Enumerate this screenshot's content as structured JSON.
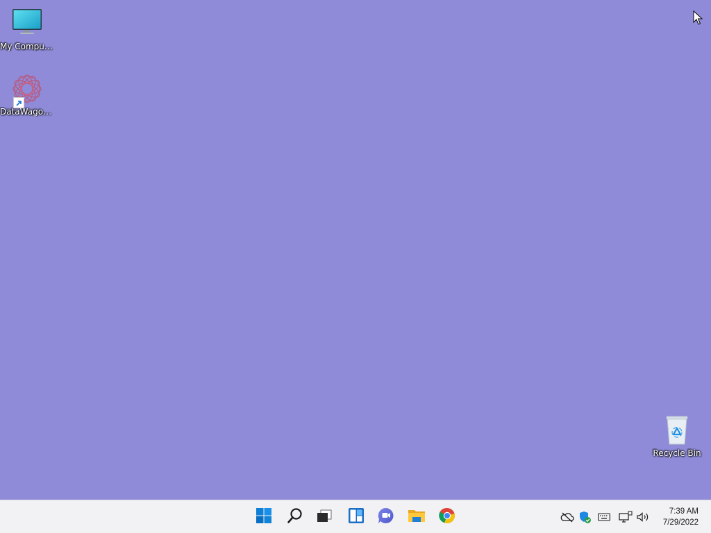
{
  "desktop": {
    "background_color": "#8f8bd8",
    "icons": [
      {
        "label": "My Computer",
        "icon": "monitor-icon"
      },
      {
        "label": "DataWagon...",
        "icon": "datawagon-shortcut-icon"
      },
      {
        "label": "Recycle Bin",
        "icon": "recycle-bin-icon"
      }
    ]
  },
  "taskbar": {
    "background_color": "#f2f2f4",
    "pinned": [
      {
        "name": "Start",
        "icon": "windows-start-icon"
      },
      {
        "name": "Search",
        "icon": "search-icon"
      },
      {
        "name": "Task View",
        "icon": "task-view-icon"
      },
      {
        "name": "Widgets",
        "icon": "widgets-icon"
      },
      {
        "name": "Chat",
        "icon": "chat-icon"
      },
      {
        "name": "File Explorer",
        "icon": "folder-icon"
      },
      {
        "name": "Google Chrome",
        "icon": "chrome-icon"
      }
    ],
    "tray": [
      {
        "icon": "onedrive-offline-icon"
      },
      {
        "icon": "windows-security-icon"
      },
      {
        "icon": "keyboard-icon"
      },
      {
        "icon": "network-icon"
      },
      {
        "icon": "volume-icon"
      }
    ],
    "clock": {
      "time": "7:39 AM",
      "date": "7/29/2022"
    }
  }
}
